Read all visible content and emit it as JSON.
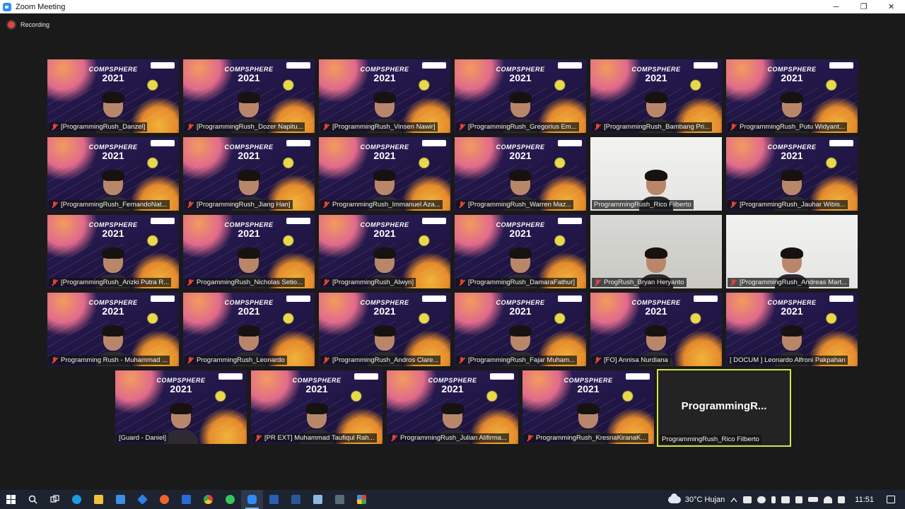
{
  "window": {
    "title": "Zoom Meeting",
    "controls": [
      "─",
      "❐",
      "✕"
    ]
  },
  "recording": {
    "label": "Recording"
  },
  "participants": [
    {
      "name": "[ProgrammingRush_Danzel]",
      "muted": true,
      "bg": "space"
    },
    {
      "name": "[ProgrammingRush_Dozer Napitu...",
      "muted": true,
      "bg": "space"
    },
    {
      "name": "[ProgrammingRush_Vinsen Nawir]",
      "muted": true,
      "bg": "space"
    },
    {
      "name": "[ProgrammingRush_Gregorius Em...",
      "muted": true,
      "bg": "space"
    },
    {
      "name": "[ProgrammingRush_Bambang Pri...",
      "muted": true,
      "bg": "space"
    },
    {
      "name": "ProgrammingRush_Putu Widyant...",
      "muted": true,
      "bg": "space"
    },
    {
      "name": "[ProgrammingRush_FernandoNat...",
      "muted": true,
      "bg": "space"
    },
    {
      "name": "[ProgrammingRush_Jiang Han]",
      "muted": true,
      "bg": "space"
    },
    {
      "name": "ProgrammingRush_Immanuel Aza...",
      "muted": true,
      "bg": "space"
    },
    {
      "name": "[ProgrammingRush_Warren Maz...",
      "muted": true,
      "bg": "space"
    },
    {
      "name": "ProgrammingRush_Rico Filberto",
      "muted": false,
      "bg": "white"
    },
    {
      "name": "[ProgrammingRush_Jauhar Wibis...",
      "muted": true,
      "bg": "space"
    },
    {
      "name": "[ProgrammingRush_Arizki Putra R...",
      "muted": true,
      "bg": "space"
    },
    {
      "name": "ProgammingRush_Nicholas Setio...",
      "muted": true,
      "bg": "space"
    },
    {
      "name": "[ProgrammingRush_Alwyn]",
      "muted": true,
      "bg": "space"
    },
    {
      "name": "[ProgrammingRush_DamaraFathur]",
      "muted": true,
      "bg": "space"
    },
    {
      "name": "ProgRush_Bryan Heryanto",
      "muted": true,
      "bg": "plain"
    },
    {
      "name": "[ProgrammingRush_Andreas Mart...",
      "muted": true,
      "bg": "white"
    },
    {
      "name": "Programming Rush - Muhammad ...",
      "muted": true,
      "bg": "space"
    },
    {
      "name": "ProgrammingRush_Leonardo",
      "muted": true,
      "bg": "space"
    },
    {
      "name": "[ProgrammingRush_Andros Clare...",
      "muted": true,
      "bg": "space"
    },
    {
      "name": "[ProgrammingRush_Fajar Muham...",
      "muted": true,
      "bg": "space"
    },
    {
      "name": "[FO] Annisa Nurdiana",
      "muted": true,
      "bg": "space"
    },
    {
      "name": "[ DOCUM ] Leonardo Alfroni Pakpahan",
      "muted": false,
      "bg": "space"
    },
    {
      "name": "[Guard - Daniel]",
      "muted": false,
      "bg": "space"
    },
    {
      "name": "[PR EXT] Muhammad Taufiqul Rah...",
      "muted": true,
      "bg": "space"
    },
    {
      "name": "ProgrammingRush_Julian Alifirma...",
      "muted": true,
      "bg": "space"
    },
    {
      "name": "ProgrammingRush_KresnaKiranaK...",
      "muted": true,
      "bg": "space"
    }
  ],
  "active_speaker": {
    "big_label": "ProgrammingR...",
    "name": "ProgrammingRush_Rico Filberto"
  },
  "background_branding": {
    "event": "COMPSPHERE",
    "year": "2021"
  },
  "taskbar": {
    "icons": [
      "windows-start-icon",
      "search-icon",
      "task-view-icon",
      "edge-icon",
      "file-explorer-icon",
      "mail-icon",
      "dropbox-icon",
      "firefox-icon",
      "app-icon",
      "chrome-icon",
      "whatsapp-icon",
      "zoom-icon",
      "code-icon",
      "word-icon",
      "notepad-icon",
      "calculator-icon",
      "paint-icon"
    ],
    "active_icon": "zoom-icon",
    "weather": "30°C Hujan",
    "time": "11:51"
  },
  "colors": {
    "active_border": "#d6e24d",
    "mic_muted": "#e0443e",
    "recording_dot": "#e0443e",
    "taskbar_bg": "#1d2430"
  }
}
